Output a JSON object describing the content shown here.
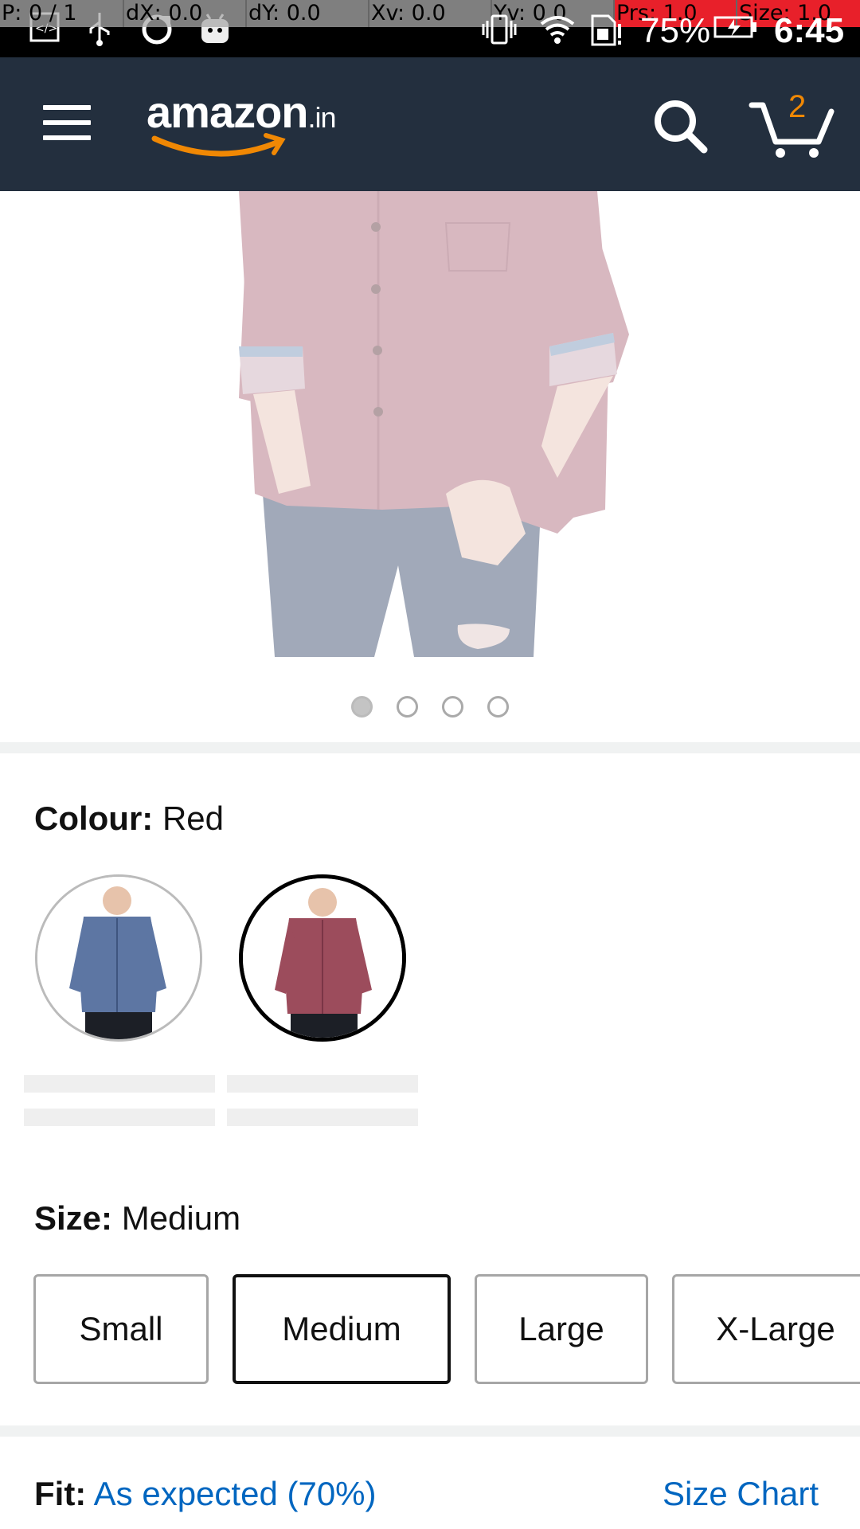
{
  "debug_overlay": {
    "p": "P: 0 / 1",
    "dx": "dX: 0.0",
    "dy": "dY: 0.0",
    "xv": "Xv: 0.0",
    "yv": "Yv: 0.0",
    "prs": "Prs: 1.0",
    "size": "Size: 1.0"
  },
  "status_bar": {
    "battery": "75%",
    "time": "6:45"
  },
  "header": {
    "logo_text": "amazon",
    "logo_tld": ".in",
    "cart_count": "2",
    "colors": {
      "background": "#232f3e",
      "accent": "#f08804"
    }
  },
  "carousel": {
    "dot_count": 4,
    "active_index": 0
  },
  "colour": {
    "label": "Colour:",
    "value": "Red",
    "swatches": [
      {
        "name": "blue",
        "selected": false
      },
      {
        "name": "red",
        "selected": true
      }
    ]
  },
  "size": {
    "label": "Size:",
    "value": "Medium",
    "options": [
      "Small",
      "Medium",
      "Large",
      "X-Large"
    ],
    "selected": "Medium"
  },
  "fit": {
    "label": "Fit:",
    "value": "As expected (70%)",
    "size_chart_link": "Size Chart"
  }
}
